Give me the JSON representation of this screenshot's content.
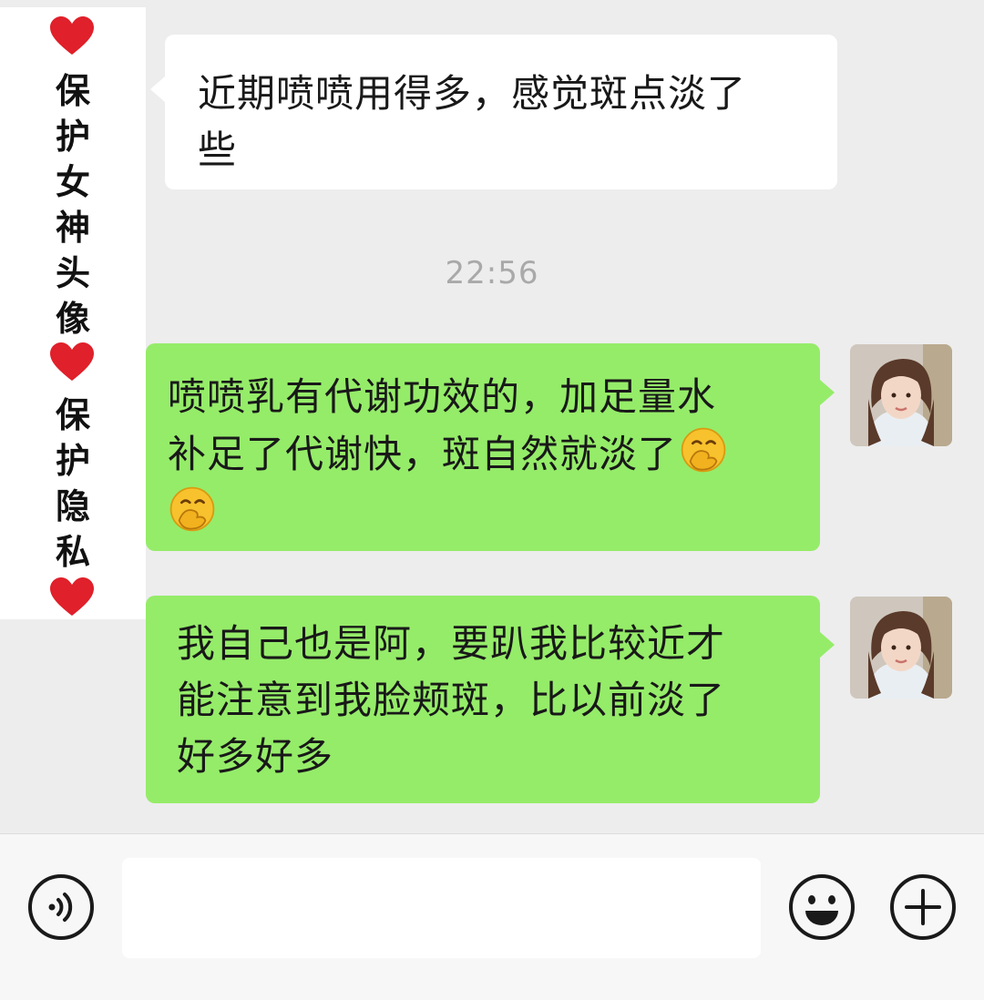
{
  "chat": {
    "messages": [
      {
        "side": "left",
        "text": "近期喷喷用得多，感觉斑点淡了\n些"
      },
      {
        "side": "right",
        "text": "喷喷乳有代谢功效的，加足量水\n补足了代谢快，斑自然就淡了",
        "trailing_emoji": "hand-over-mouth-emoji",
        "trailing_emoji_2": "hand-over-mouth-emoji"
      },
      {
        "side": "right",
        "text": "我自己也是阿，要趴我比较近才\n能注意到我脸颊斑，比以前淡了\n好多好多"
      }
    ],
    "timestamp": "22:56"
  },
  "overlay": {
    "chars_1": [
      "保",
      "护",
      "女",
      "神",
      "头",
      "像"
    ],
    "chars_2": [
      "保",
      "护",
      "隐",
      "私"
    ],
    "heart_icon": "red-heart-icon",
    "heart_color": "#e0202a"
  },
  "input_bar": {
    "voice_icon": "voice-input-icon",
    "emoji_icon": "emoji-icon",
    "plus_icon": "plus-icon"
  },
  "colors": {
    "background": "#ededed",
    "bubble_self": "#95ec69",
    "bubble_other": "#ffffff",
    "timestamp_text": "#a9a9a9"
  }
}
